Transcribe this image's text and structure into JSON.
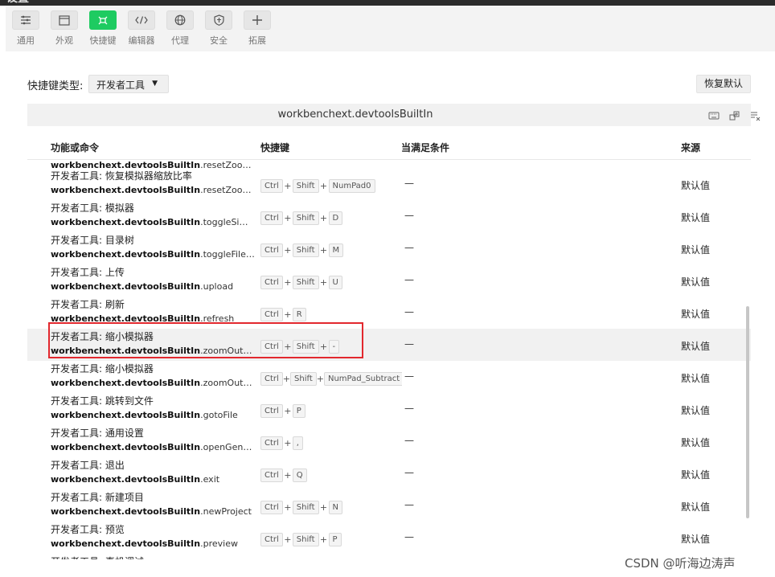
{
  "window": {
    "title": "设置"
  },
  "toolbar": {
    "items": [
      {
        "label": "通用",
        "icon": "sliders-icon"
      },
      {
        "label": "外观",
        "icon": "window-icon"
      },
      {
        "label": "快捷键",
        "icon": "command-icon"
      },
      {
        "label": "编辑器",
        "icon": "code-icon"
      },
      {
        "label": "代理",
        "icon": "globe-icon"
      },
      {
        "label": "安全",
        "icon": "shield-icon"
      },
      {
        "label": "拓展",
        "icon": "plus-icon"
      }
    ],
    "active_index": 2,
    "active_color": "#1ecb61"
  },
  "filter": {
    "type_label": "快捷键类型:",
    "type_value": "开发者工具",
    "restore_label": "恢复默认"
  },
  "search": {
    "value": "workbenchext.devtoolsBuiltIn",
    "icons": [
      "keyboard-icon",
      "sort-icon",
      "clear-filter-icon"
    ]
  },
  "table": {
    "headers": {
      "command": "功能或命令",
      "keybinding": "快捷键",
      "when": "当满足条件",
      "source": "来源"
    },
    "clipped_top": {
      "prefix": "workbenchext.devtoolsBuiltIn",
      "suffix": ".resetZoomSim..."
    },
    "rows": [
      {
        "title": "开发者工具: 恢复模拟器缩放比率",
        "prefix": "workbenchext.devtoolsBuiltIn",
        "suffix": ".resetZoomSim...",
        "keys": [
          "Ctrl",
          "Shift",
          "NumPad0"
        ],
        "when": "—",
        "source": "默认值"
      },
      {
        "title": "开发者工具: 模拟器",
        "prefix": "workbenchext.devtoolsBuiltIn",
        "suffix": ".toggleSimulat...",
        "keys": [
          "Ctrl",
          "Shift",
          "D"
        ],
        "when": "—",
        "source": "默认值"
      },
      {
        "title": "开发者工具: 目录树",
        "prefix": "workbenchext.devtoolsBuiltIn",
        "suffix": ".toggleFileTree",
        "keys": [
          "Ctrl",
          "Shift",
          "M"
        ],
        "when": "—",
        "source": "默认值"
      },
      {
        "title": "开发者工具: 上传",
        "prefix": "workbenchext.devtoolsBuiltIn",
        "suffix": ".upload",
        "keys": [
          "Ctrl",
          "Shift",
          "U"
        ],
        "when": "—",
        "source": "默认值"
      },
      {
        "title": "开发者工具: 刷新",
        "prefix": "workbenchext.devtoolsBuiltIn",
        "suffix": ".refresh",
        "keys": [
          "Ctrl",
          "R"
        ],
        "when": "—",
        "source": "默认值"
      },
      {
        "title": "开发者工具: 缩小模拟器",
        "prefix": "workbenchext.devtoolsBuiltIn",
        "suffix": ".zoomOutSimul...",
        "keys": [
          "Ctrl",
          "Shift",
          "-"
        ],
        "when": "—",
        "source": "默认值",
        "selected": true
      },
      {
        "title": "开发者工具: 缩小模拟器",
        "prefix": "workbenchext.devtoolsBuiltIn",
        "suffix": ".zoomOutSimul...",
        "keys": [
          "Ctrl",
          "Shift",
          "NumPad_Subtract"
        ],
        "when": "—",
        "source": "默认值"
      },
      {
        "title": "开发者工具: 跳转到文件",
        "prefix": "workbenchext.devtoolsBuiltIn",
        "suffix": ".gotoFile",
        "keys": [
          "Ctrl",
          "P"
        ],
        "when": "—",
        "source": "默认值"
      },
      {
        "title": "开发者工具: 通用设置",
        "prefix": "workbenchext.devtoolsBuiltIn",
        "suffix": ".openGeneralSe...",
        "keys": [
          "Ctrl",
          ","
        ],
        "when": "—",
        "source": "默认值"
      },
      {
        "title": "开发者工具: 退出",
        "prefix": "workbenchext.devtoolsBuiltIn",
        "suffix": ".exit",
        "keys": [
          "Ctrl",
          "Q"
        ],
        "when": "—",
        "source": "默认值"
      },
      {
        "title": "开发者工具: 新建项目",
        "prefix": "workbenchext.devtoolsBuiltIn",
        "suffix": ".newProject",
        "keys": [
          "Ctrl",
          "Shift",
          "N"
        ],
        "when": "—",
        "source": "默认值"
      },
      {
        "title": "开发者工具: 预览",
        "prefix": "workbenchext.devtoolsBuiltIn",
        "suffix": ".preview",
        "keys": [
          "Ctrl",
          "Shift",
          "P"
        ],
        "when": "—",
        "source": "默认值"
      },
      {
        "title": "开发者工具: 真机调试",
        "prefix": "",
        "suffix": "",
        "keys": [],
        "when": "",
        "source": ""
      }
    ]
  },
  "watermark": "CSDN @听海边涛声"
}
